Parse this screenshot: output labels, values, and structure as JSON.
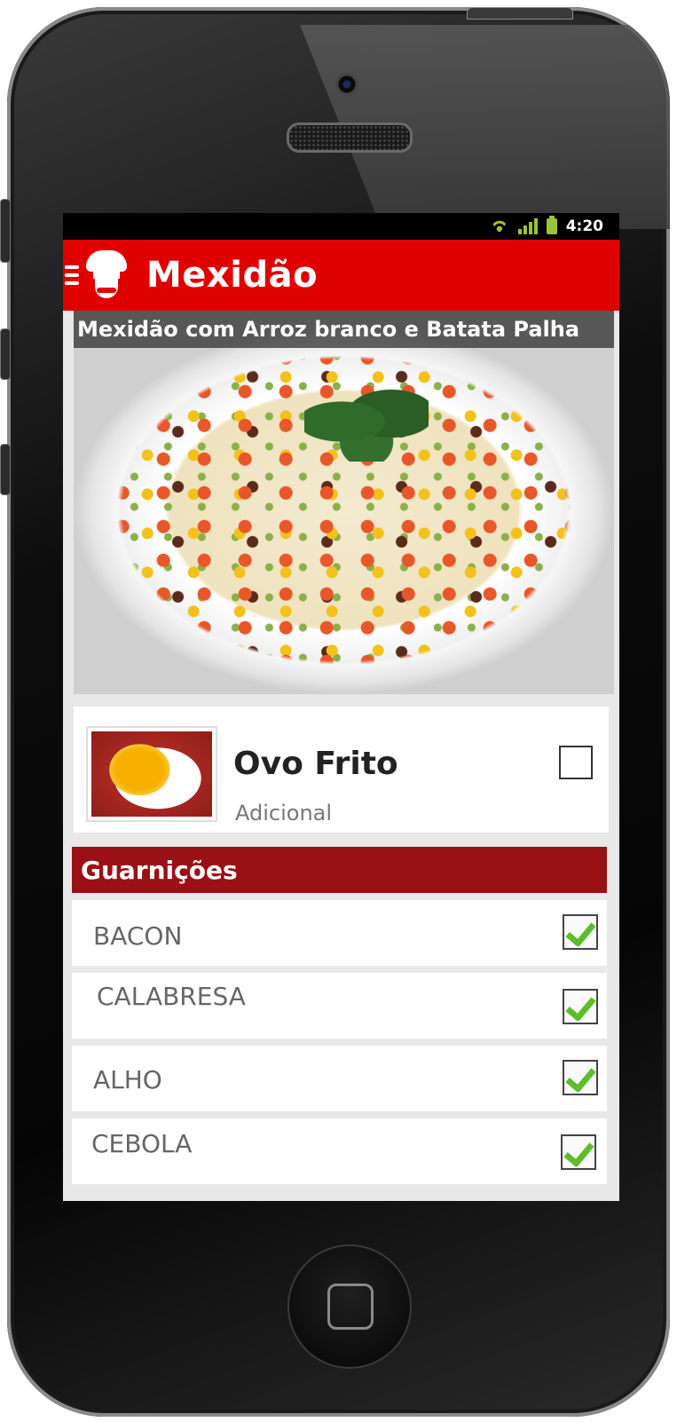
{
  "status_bar": {
    "time": "4:20",
    "icons": [
      "wifi-icon",
      "signal-icon",
      "battery-icon"
    ],
    "accent": "#9ac433"
  },
  "action_bar": {
    "title": "Mexidão",
    "background": "#e00000",
    "icons": [
      "menu-lines-icon",
      "chef-hat-icon"
    ]
  },
  "hero": {
    "caption": "Mexidão com Arroz branco e Batata Palha"
  },
  "addon": {
    "name": "Ovo Frito",
    "subtitle": "Adicional",
    "checked": false
  },
  "section": {
    "title": "Guarnições",
    "background": "#9b1015"
  },
  "garnishes": [
    {
      "label": "BACON",
      "checked": true
    },
    {
      "label": "CALABRESA",
      "checked": true
    },
    {
      "label": "ALHO",
      "checked": true
    },
    {
      "label": "CEBOLA",
      "checked": true
    }
  ]
}
